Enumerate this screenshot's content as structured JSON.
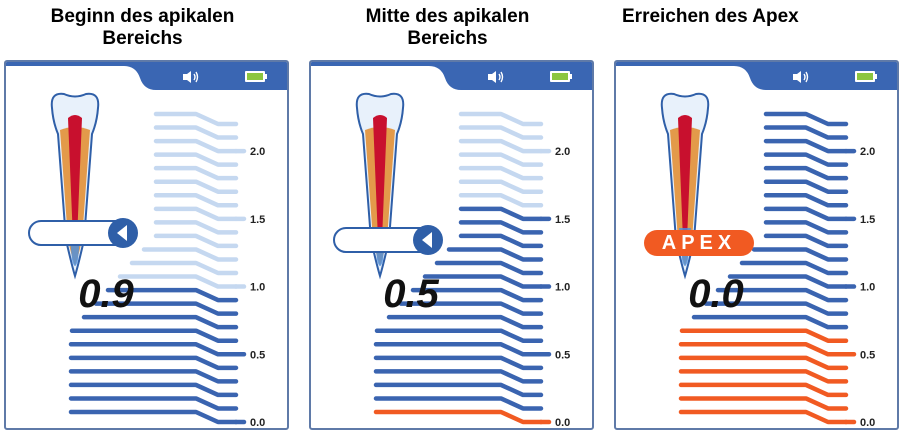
{
  "panels": [
    {
      "caption_line1": "Beginn des apikalen",
      "caption_line2": "Bereichs",
      "reading": "0.9",
      "apex_label": "",
      "indicator": "progress",
      "progress": 0.85,
      "active_bars": 10,
      "orange_bars": 0
    },
    {
      "caption_line1": "Mitte des apikalen",
      "caption_line2": "Bereichs",
      "reading": "0.5",
      "apex_label": "",
      "indicator": "progress",
      "progress": 0.92,
      "active_bars": 16,
      "orange_bars": 1
    },
    {
      "caption_line1": "Erreichen des Apex",
      "caption_line2": "",
      "reading": "0.0",
      "apex_label": "APEX",
      "indicator": "apex",
      "progress": 1.0,
      "active_bars": 23,
      "orange_bars": 7
    }
  ],
  "scale": {
    "labels": [
      "2.0",
      "1.5",
      "1.0",
      "0.5",
      "0.0"
    ],
    "total_bars": 23
  },
  "icons": {
    "sound": "speaker-icon",
    "battery": "battery-icon"
  },
  "colors": {
    "frame": "#5f7aa8",
    "header": "#3a66b3",
    "active_bar": "#3a64b0",
    "inactive_bar": "#c5d8f0",
    "apex_orange": "#f15a22",
    "battery_green": "#8cc63f"
  }
}
